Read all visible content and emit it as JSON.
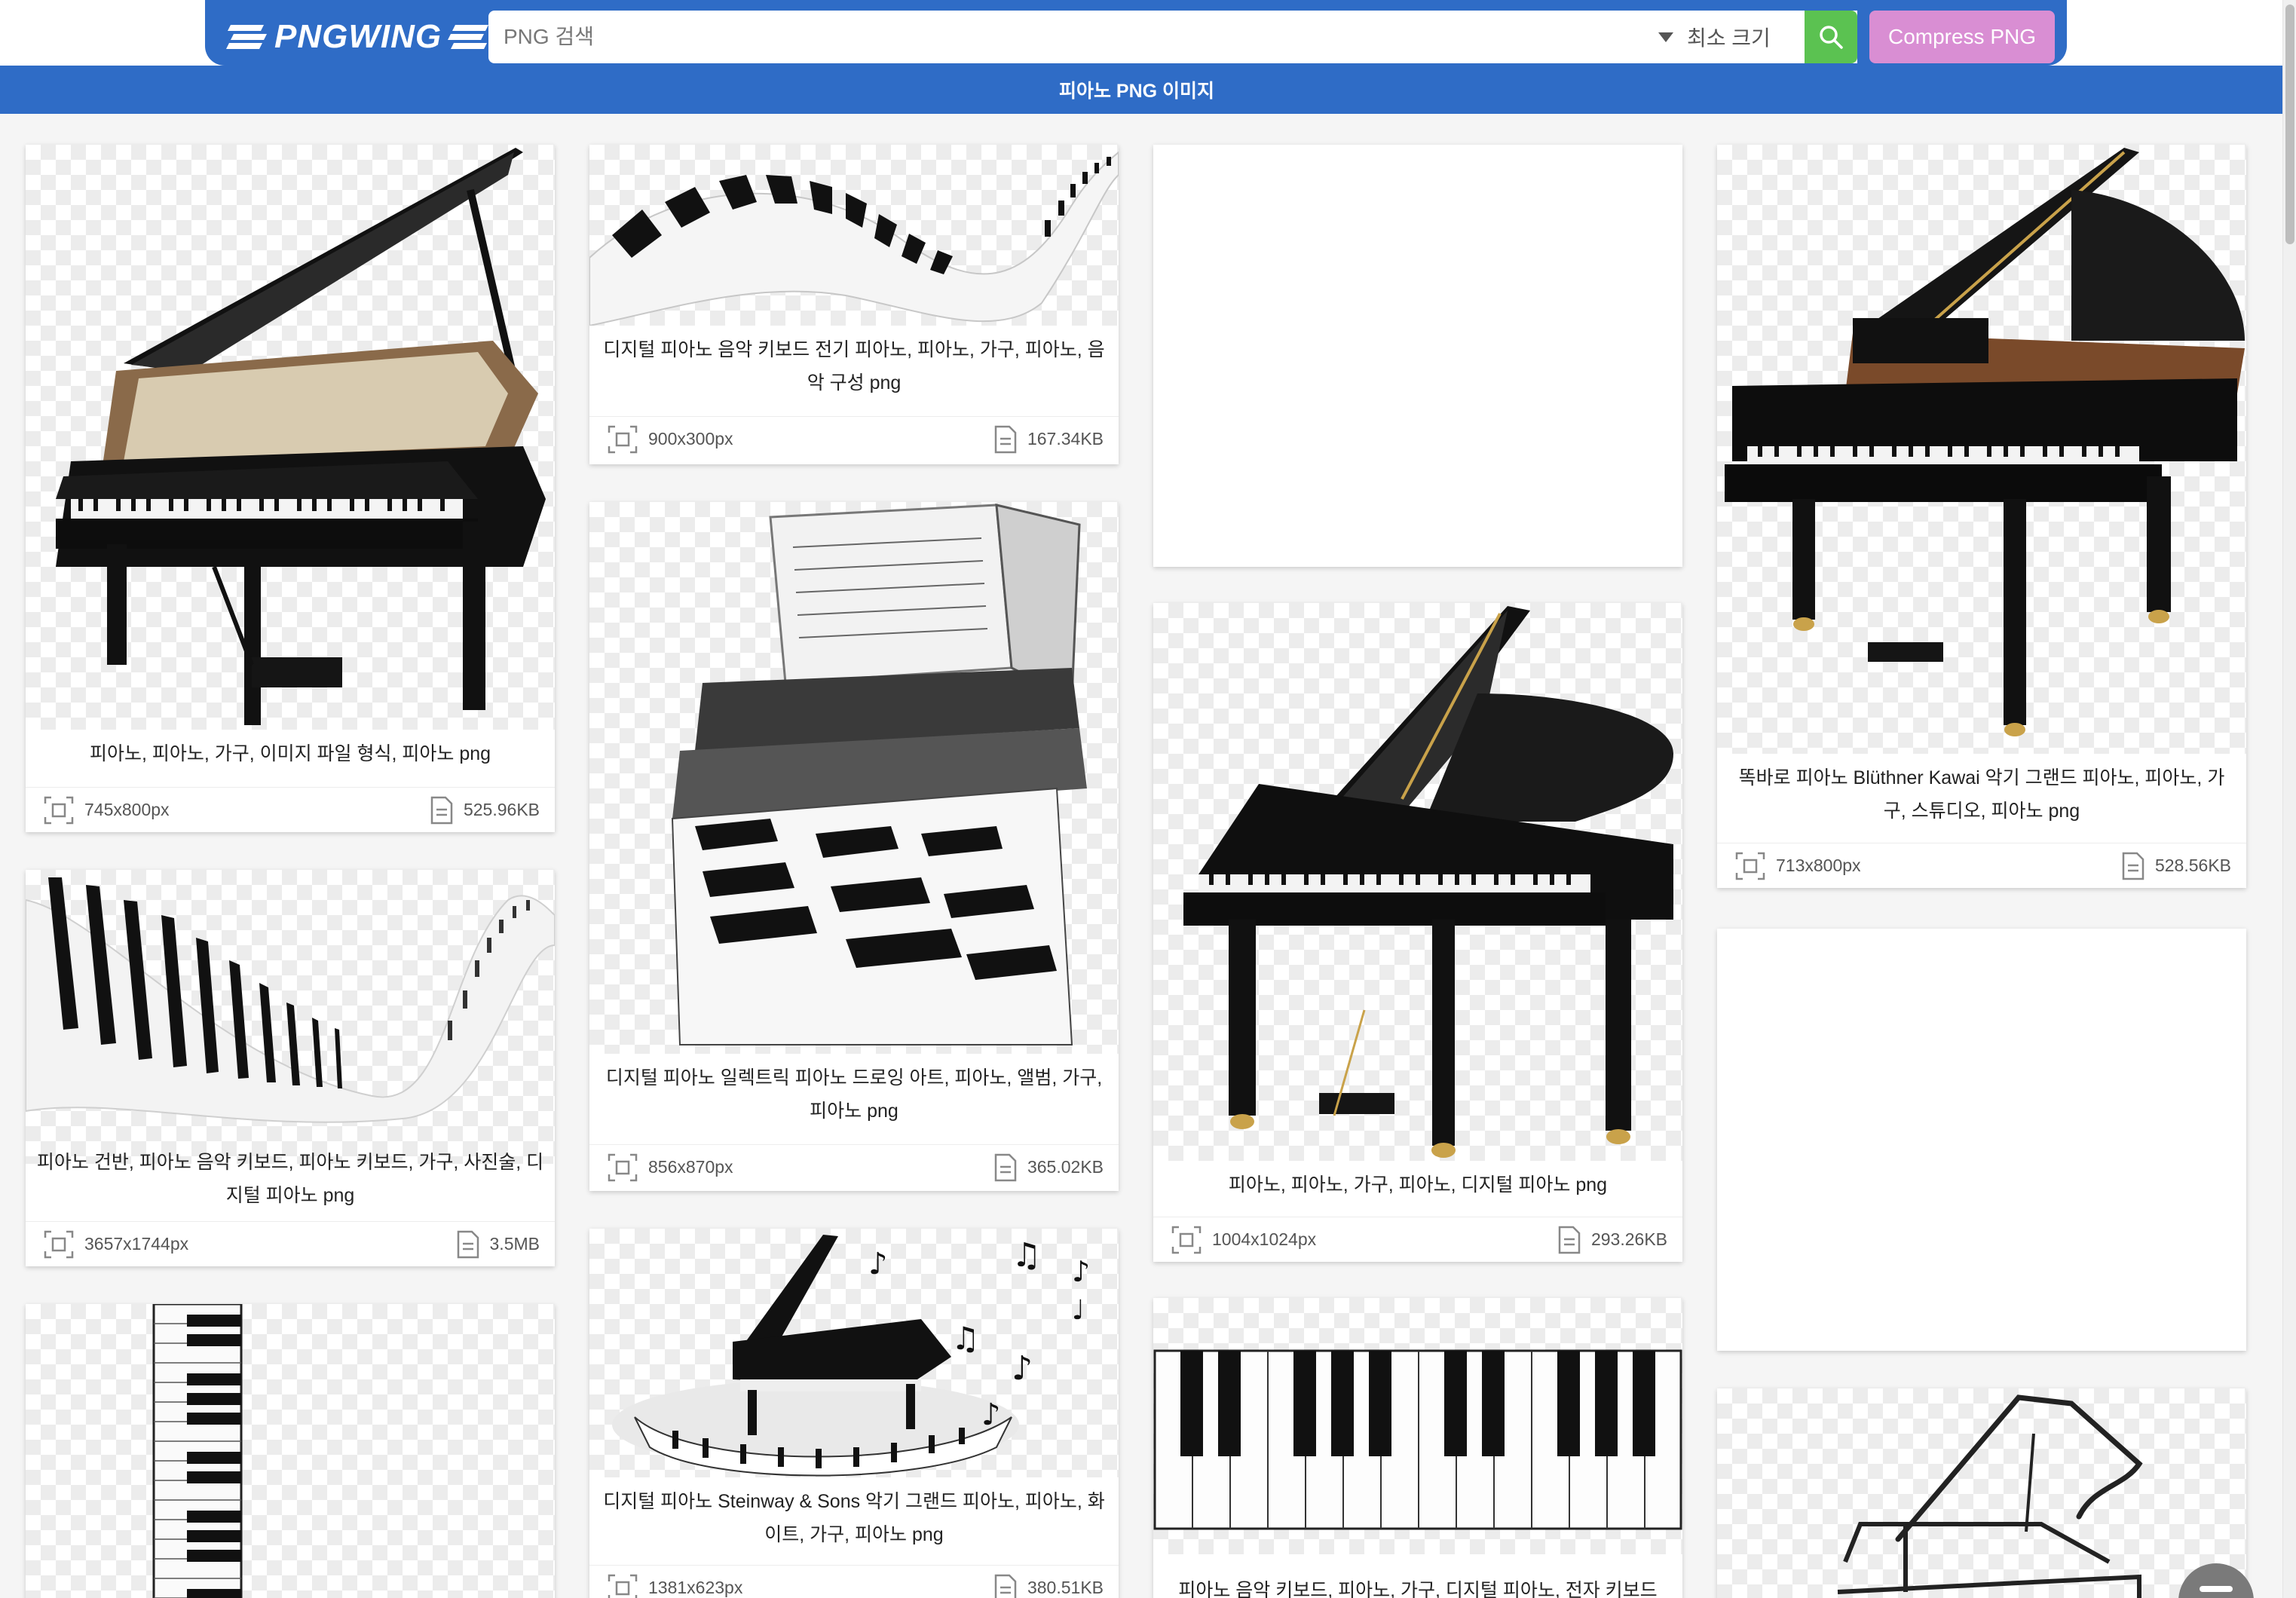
{
  "header": {
    "logo_text": "PNGWING",
    "search_placeholder": "PNG 검색",
    "size_filter": "최소 크기",
    "compress_label": "Compress PNG",
    "page_title": "피아노 PNG 이미지"
  },
  "colors": {
    "brand_blue": "#2f6cc6",
    "search_green": "#5bc251",
    "compress_pink": "#d98ed3"
  },
  "cards": [
    {
      "caption": "피아노, 피아노, 가구, 이미지 파일 형식, 피아노 png",
      "dims": "745x800px",
      "size": "525.96KB"
    },
    {
      "caption": "디지털 피아노 음악 키보드 전기 피아노, 피아노, 가구, 피아노, 음악 구성 png",
      "dims": "900x300px",
      "size": "167.34KB"
    },
    {
      "caption": "디지털 피아노 일렉트릭 피아노 드로잉 아트, 피아노, 앨범, 가구, 피아노 png",
      "dims": "856x870px",
      "size": "365.02KB"
    },
    {
      "caption": "피아노 건반, 피아노 음악 키보드, 피아노 키보드, 가구, 사진술, 디지털 피아노 png",
      "dims": "3657x1744px",
      "size": "3.5MB"
    },
    {
      "caption": "디지털 피아노 Steinway & Sons 악기 그랜드 피아노, 피아노, 화이트, 가구, 피아노 png",
      "dims": "1381x623px",
      "size": "380.51KB"
    },
    {
      "caption": "피아노, 피아노, 가구, 피아노, 디지털 피아노 png",
      "dims": "1004x1024px",
      "size": "293.26KB"
    },
    {
      "caption": "피아노 음악 키보드, 피아노, 가구, 디지털 피아노, 전자 키보드 png",
      "dims": "",
      "size": ""
    },
    {
      "caption": "똑바로 피아노 Blüthner Kawai 악기 그랜드 피아노, 피아노, 가구, 스튜디오, 피아노 png",
      "dims": "713x800px",
      "size": "528.56KB"
    }
  ]
}
